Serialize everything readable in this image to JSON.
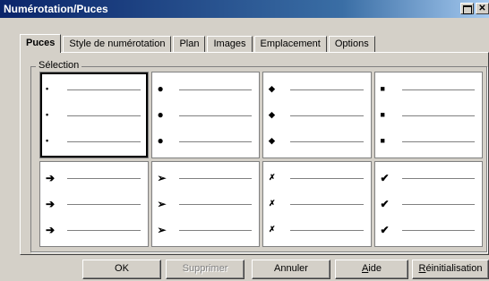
{
  "window": {
    "title": "Numérotation/Puces"
  },
  "tabs": [
    {
      "label": "Puces",
      "active": true
    },
    {
      "label": "Style de numérotation"
    },
    {
      "label": "Plan"
    },
    {
      "label": "Images"
    },
    {
      "label": "Emplacement"
    },
    {
      "label": "Options"
    }
  ],
  "selection": {
    "label": "Sélection",
    "cells": [
      {
        "symbol": "•",
        "icon": "small-dot-bullet-icon",
        "selected": true
      },
      {
        "symbol": "●",
        "icon": "large-dot-bullet-icon"
      },
      {
        "symbol": "◆",
        "icon": "diamond-bullet-icon"
      },
      {
        "symbol": "■",
        "icon": "square-bullet-icon"
      },
      {
        "symbol": "➔",
        "icon": "arrow-bullet-icon"
      },
      {
        "symbol": "➢",
        "icon": "arrowhead-bullet-icon"
      },
      {
        "symbol": "✗",
        "icon": "cross-bullet-icon"
      },
      {
        "symbol": "✔",
        "icon": "checkmark-bullet-icon"
      }
    ]
  },
  "buttons": {
    "ok": "OK",
    "supprimer": "Supprimer",
    "annuler": "Annuler",
    "aide_prefix": "",
    "aide_u": "A",
    "aide_rest": "ide",
    "reinit_u": "R",
    "reinit_rest": "éinitialisation"
  }
}
